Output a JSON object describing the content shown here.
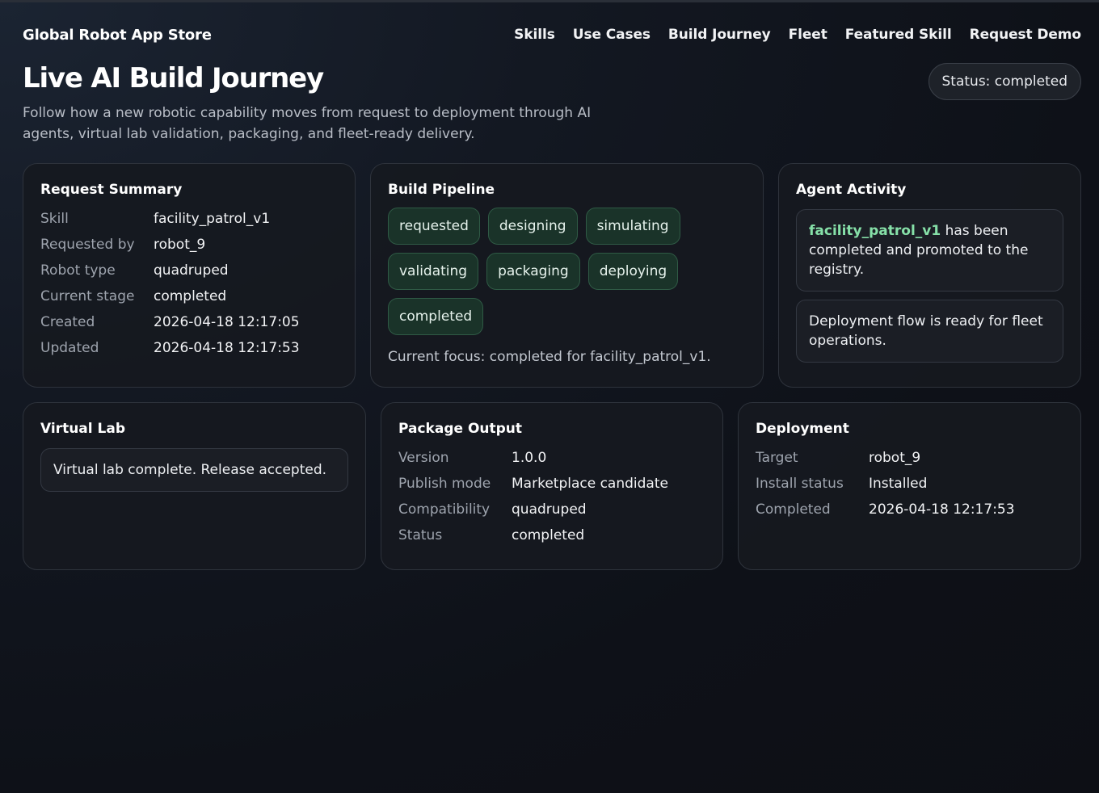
{
  "app": {
    "brand": "Global Robot App Store"
  },
  "nav": [
    "Skills",
    "Use Cases",
    "Build Journey",
    "Fleet",
    "Featured Skill",
    "Request Demo"
  ],
  "page": {
    "title": "Live AI Build Journey",
    "status": "Status: completed",
    "subtitle": "Follow how a new robotic capability moves from request to deployment through AI agents, virtual lab validation, packaging, and fleet-ready delivery."
  },
  "request_summary": {
    "title": "Request Summary",
    "rows": [
      {
        "k": "Skill",
        "v": "facility_patrol_v1"
      },
      {
        "k": "Requested by",
        "v": "robot_9"
      },
      {
        "k": "Robot type",
        "v": "quadruped"
      },
      {
        "k": "Current stage",
        "v": "completed"
      },
      {
        "k": "Created",
        "v": "2026-04-18 12:17:05"
      },
      {
        "k": "Updated",
        "v": "2026-04-18 12:17:53"
      }
    ]
  },
  "pipeline": {
    "title": "Build Pipeline",
    "stages": [
      "requested",
      "designing",
      "simulating",
      "validating",
      "packaging",
      "deploying",
      "completed"
    ],
    "focus": "Current focus: completed for facility_patrol_v1.",
    "stage_color": "#1a3329"
  },
  "agent_activity": {
    "title": "Agent Activity",
    "messages": [
      {
        "highlight": "facility_patrol_v1",
        "text": " has been completed and promoted to the registry."
      },
      {
        "highlight": "",
        "text": "Deployment flow is ready for fleet operations."
      }
    ],
    "highlight_color": "#86e0a8"
  },
  "virtual_lab": {
    "title": "Virtual Lab",
    "message": "Virtual lab complete. Release accepted."
  },
  "package_output": {
    "title": "Package Output",
    "rows": [
      {
        "k": "Version",
        "v": "1.0.0"
      },
      {
        "k": "Publish mode",
        "v": "Marketplace candidate"
      },
      {
        "k": "Compatibility",
        "v": "quadruped"
      },
      {
        "k": "Status",
        "v": "completed"
      }
    ]
  },
  "deployment": {
    "title": "Deployment",
    "rows": [
      {
        "k": "Target",
        "v": "robot_9"
      },
      {
        "k": "Install status",
        "v": "Installed"
      },
      {
        "k": "Completed",
        "v": "2026-04-18 12:17:53"
      }
    ]
  }
}
